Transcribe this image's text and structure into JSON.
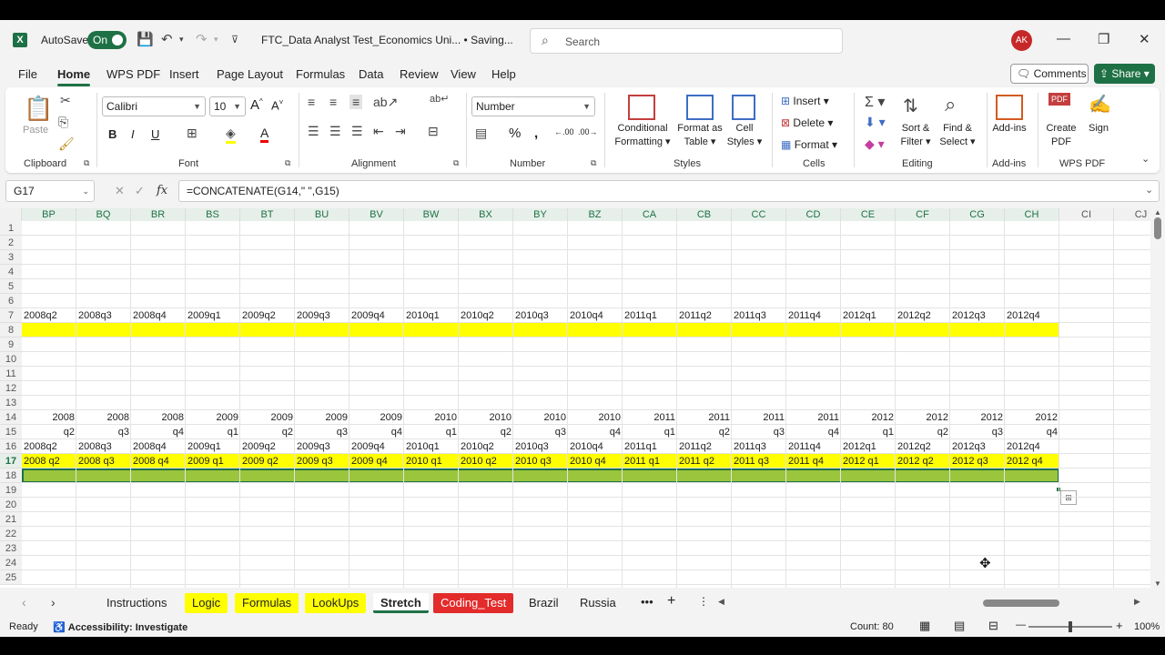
{
  "titlebar": {
    "autosave_label": "AutoSave",
    "autosave_state": "On",
    "doc_title": "FTC_Data Analyst Test_Economics Uni... • Saving...",
    "search_placeholder": "Search",
    "user_initials": "AK"
  },
  "menu": {
    "items": [
      "File",
      "Home",
      "WPS PDF",
      "Insert",
      "Page Layout",
      "Formulas",
      "Data",
      "Review",
      "View",
      "Help"
    ],
    "active": "Home",
    "comments_label": "Comments",
    "share_label": "Share"
  },
  "ribbon": {
    "clipboard": {
      "paste": "Paste",
      "label": "Clipboard"
    },
    "font": {
      "name": "Calibri",
      "size": "10",
      "label": "Font"
    },
    "alignment": {
      "label": "Alignment"
    },
    "number": {
      "format": "Number",
      "label": "Number"
    },
    "styles": {
      "conditional_1": "Conditional",
      "conditional_2": "Formatting",
      "format_table_1": "Format as",
      "format_table_2": "Table",
      "cell_styles_1": "Cell",
      "cell_styles_2": "Styles",
      "label": "Styles"
    },
    "cells": {
      "insert": "Insert",
      "delete": "Delete",
      "format": "Format",
      "label": "Cells"
    },
    "editing": {
      "sort_1": "Sort &",
      "sort_2": "Filter",
      "find_1": "Find &",
      "find_2": "Select",
      "label": "Editing"
    },
    "addins": {
      "button": "Add-ins",
      "label": "Add-ins"
    },
    "wps": {
      "create_1": "Create",
      "create_2": "PDF",
      "sign": "Sign",
      "label": "WPS PDF"
    }
  },
  "formula_bar": {
    "name_box": "G17",
    "fx": "fx",
    "formula": "=CONCATENATE(G14,\" \",G15)"
  },
  "columns": [
    "BP",
    "BQ",
    "BR",
    "BS",
    "BT",
    "BU",
    "BV",
    "BW",
    "BX",
    "BY",
    "BZ",
    "CA",
    "CB",
    "CC",
    "CD",
    "CE",
    "CF",
    "CG",
    "CH",
    "CI",
    "CJ"
  ],
  "row_numbers": [
    1,
    2,
    3,
    4,
    5,
    6,
    7,
    8,
    9,
    10,
    11,
    12,
    13,
    14,
    15,
    16,
    17,
    18,
    19,
    20,
    21,
    22,
    23,
    24,
    25
  ],
  "rows": {
    "r7": [
      "2008q2",
      "2008q3",
      "2008q4",
      "2009q1",
      "2009q2",
      "2009q3",
      "2009q4",
      "2010q1",
      "2010q2",
      "2010q3",
      "2010q4",
      "2011q1",
      "2011q2",
      "2011q3",
      "2011q4",
      "2012q1",
      "2012q2",
      "2012q3",
      "2012q4"
    ],
    "r14": [
      "2008",
      "2008",
      "2008",
      "2009",
      "2009",
      "2009",
      "2009",
      "2010",
      "2010",
      "2010",
      "2010",
      "2011",
      "2011",
      "2011",
      "2011",
      "2012",
      "2012",
      "2012",
      "2012"
    ],
    "r15": [
      "q2",
      "q3",
      "q4",
      "q1",
      "q2",
      "q3",
      "q4",
      "q1",
      "q2",
      "q3",
      "q4",
      "q1",
      "q2",
      "q3",
      "q4",
      "q1",
      "q2",
      "q3",
      "q4"
    ],
    "r16": [
      "2008q2",
      "2008q3",
      "2008q4",
      "2009q1",
      "2009q2",
      "2009q3",
      "2009q4",
      "2010q1",
      "2010q2",
      "2010q3",
      "2010q4",
      "2011q1",
      "2011q2",
      "2011q3",
      "2011q4",
      "2012q1",
      "2012q2",
      "2012q3",
      "2012q4"
    ],
    "r17": [
      "2008 q2",
      "2008 q3",
      "2008 q4",
      "2009 q1",
      "2009 q2",
      "2009 q3",
      "2009 q4",
      "2010 q1",
      "2010 q2",
      "2010 q3",
      "2010 q4",
      "2011 q1",
      "2011 q2",
      "2011 q3",
      "2011 q4",
      "2012 q1",
      "2012 q2",
      "2012 q3",
      "2012 q4"
    ]
  },
  "sheet_tabs": [
    {
      "label": "Instructions",
      "style": "plain"
    },
    {
      "label": "Logic",
      "style": "yellow"
    },
    {
      "label": "Formulas",
      "style": "yellow"
    },
    {
      "label": "LookUps",
      "style": "yellow"
    },
    {
      "label": "Stretch",
      "style": "active"
    },
    {
      "label": "Coding_Test",
      "style": "red"
    },
    {
      "label": "Brazil",
      "style": "plain"
    },
    {
      "label": "Russia",
      "style": "plain"
    }
  ],
  "status": {
    "ready": "Ready",
    "accessibility": "Accessibility: Investigate",
    "count": "Count: 80",
    "zoom": "100%"
  },
  "colors": {
    "accent": "#1e7145",
    "yellow": "#ffff00",
    "green_fill": "#9bc53d",
    "red_tab": "#e32b2b"
  }
}
